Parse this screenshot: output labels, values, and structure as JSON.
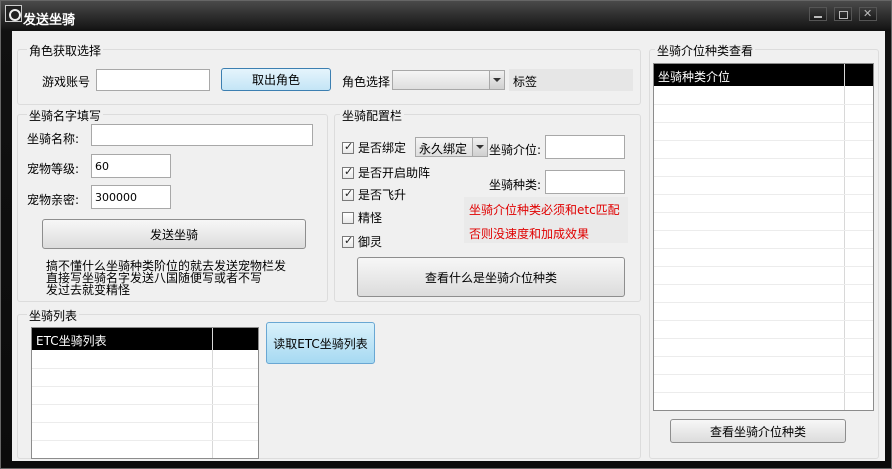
{
  "window": {
    "title": "发送坐骑",
    "icon": "app-icon"
  },
  "role": {
    "group_title": "角色获取选择",
    "account_label": "游戏账号",
    "account_value": "",
    "fetch_button": "取出角色",
    "select_label": "角色选择",
    "selected_role": "",
    "tag_label": "标签"
  },
  "name": {
    "group_title": "坐骑名字填写",
    "mount_name_label": "坐骑名称:",
    "mount_name_value": "",
    "pet_level_label": "宠物等级:",
    "pet_level_value": "60",
    "pet_intimacy_label": "宠物亲密:",
    "pet_intimacy_value": "300000",
    "send_button": "发送坐骑",
    "note_line1": "搞不懂什么坐骑种类阶位的就去发送宠物栏发",
    "note_line2": "直接写坐骑名字发送八国随便写或者不写",
    "note_line3": "发过去就变精怪"
  },
  "config": {
    "group_title": "坐骑配置栏",
    "bind_label": "是否绑定",
    "bind_checked": true,
    "bind_type": "永久绑定",
    "formation_label": "是否开启助阵",
    "formation_checked": true,
    "ascend_label": "是否飞升",
    "ascend_checked": true,
    "spirit_label": "精怪",
    "spirit_checked": false,
    "yuling_label": "御灵",
    "yuling_checked": true,
    "mount_tier_label": "坐骑介位:",
    "mount_tier_value": "",
    "mount_type_label": "坐骑种类:",
    "mount_type_value": "",
    "warning_line1": "坐骑介位种类必须和etc匹配",
    "warning_line2": "否则没速度和加成效果",
    "view_button": "查看什么是坐骑介位种类"
  },
  "list": {
    "group_title": "坐骑列表",
    "column_header": "ETC坐骑列表",
    "read_button": "读取ETC坐骑列表"
  },
  "types": {
    "group_title": "坐骑介位种类查看",
    "column_header": "坐骑种类介位",
    "view_button": "查看坐骑介位种类"
  }
}
